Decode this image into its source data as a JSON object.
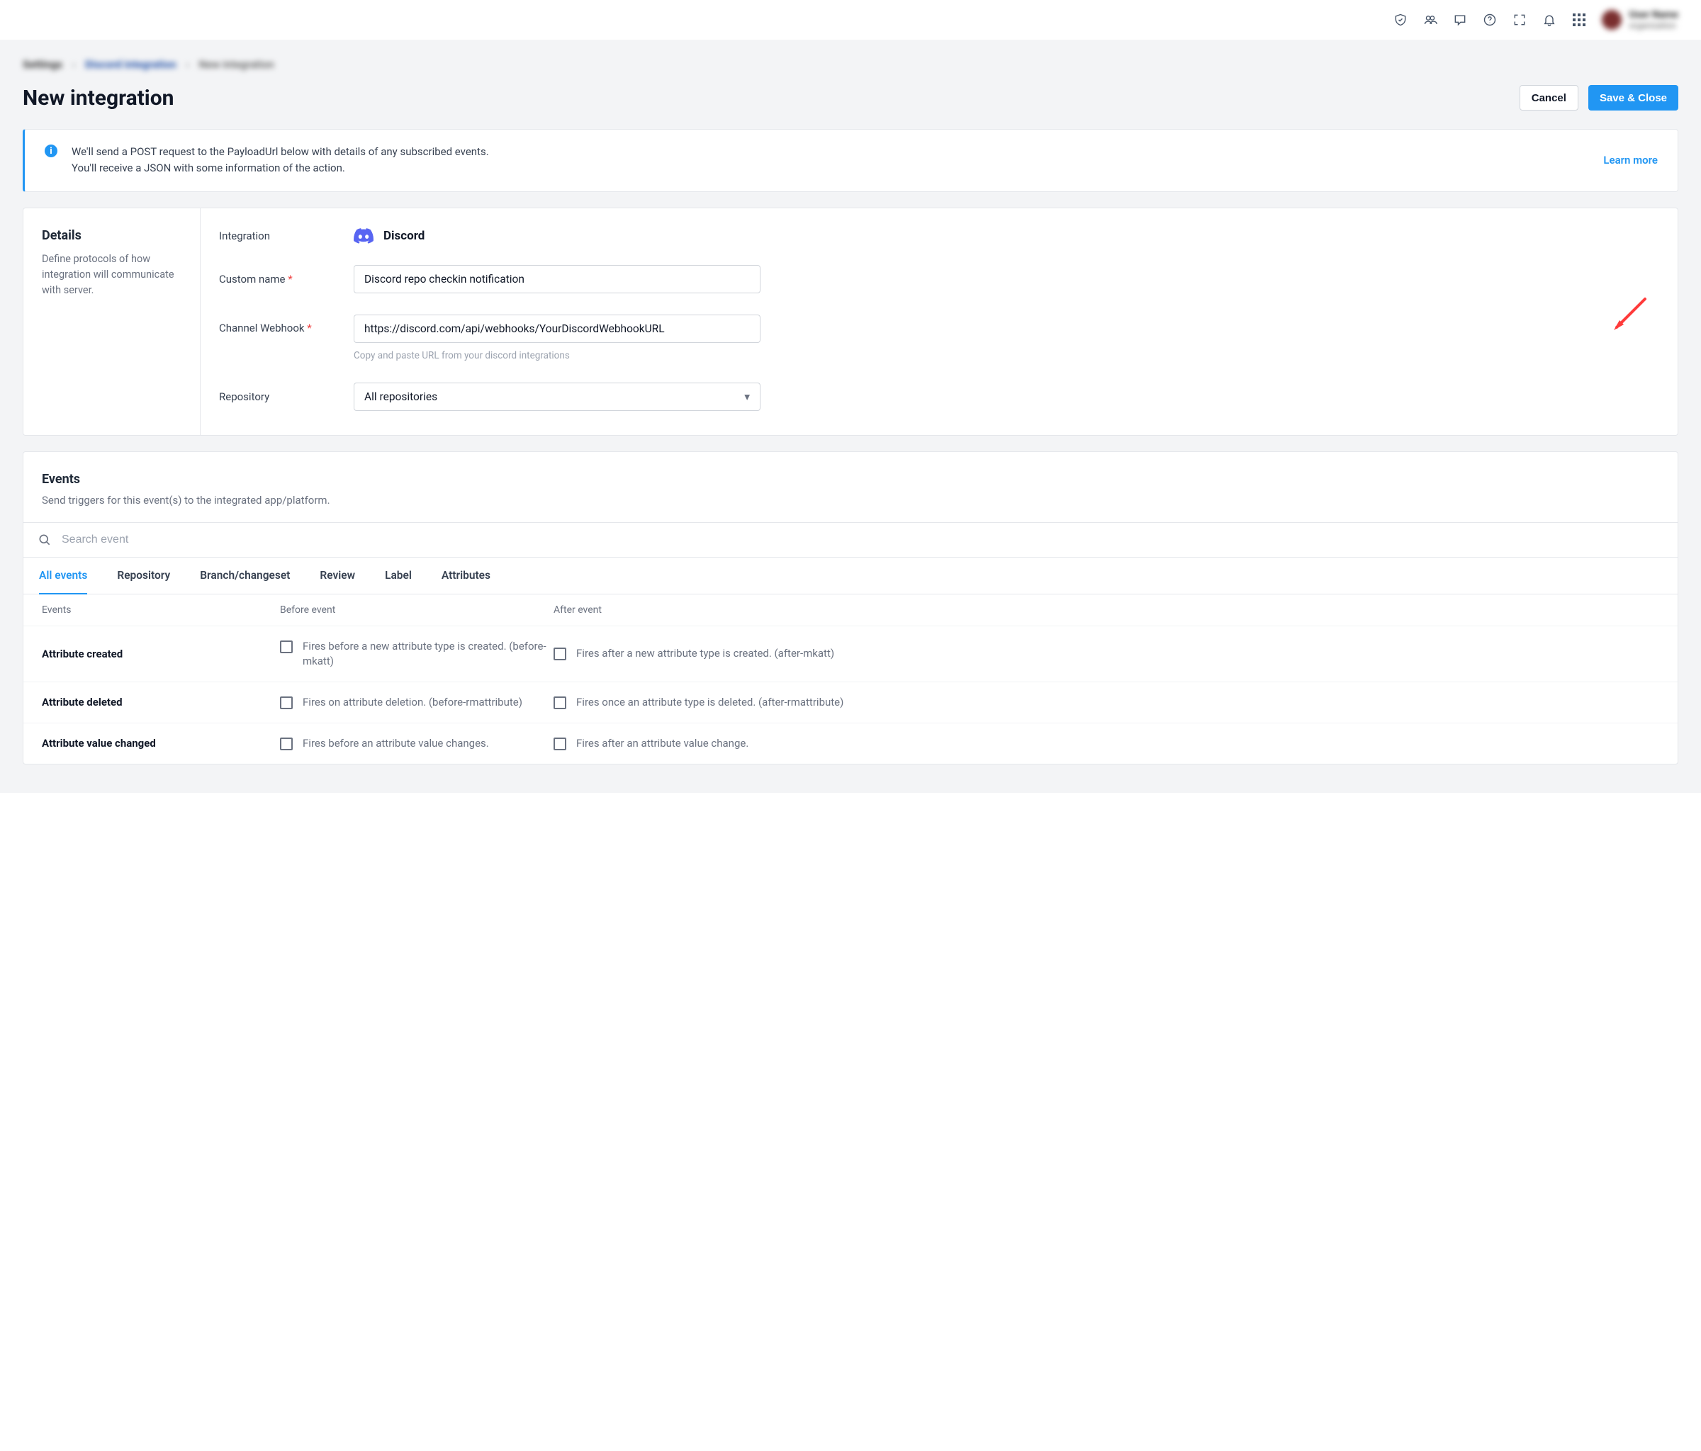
{
  "topnav": {
    "user_name": "User Name",
    "user_org": "organization"
  },
  "breadcrumb": {
    "a": "Settings",
    "b": "Discord integration",
    "c": "New integration"
  },
  "page_title": "New integration",
  "buttons": {
    "cancel": "Cancel",
    "save": "Save & Close"
  },
  "infobox": {
    "line1": "We'll send a POST request to the PayloadUrl below with details of any subscribed events.",
    "line2": "You'll receive a JSON with some information of the action.",
    "learn": "Learn more"
  },
  "details": {
    "heading": "Details",
    "desc": "Define protocols of how integration will communicate with server.",
    "fields": {
      "integration_label": "Integration",
      "integration_value": "Discord",
      "custom_name_label": "Custom name",
      "custom_name_value": "Discord repo checkin notification",
      "webhook_label": "Channel Webhook",
      "webhook_value": "https://discord.com/api/webhooks/YourDiscordWebhookURL",
      "webhook_helper": "Copy and paste URL from your discord integrations",
      "repo_label": "Repository",
      "repo_value": "All repositories"
    }
  },
  "events": {
    "heading": "Events",
    "desc": "Send triggers for this event(s) to the integrated app/platform.",
    "search_placeholder": "Search event",
    "tabs": [
      "All events",
      "Repository",
      "Branch/changeset",
      "Review",
      "Label",
      "Attributes"
    ],
    "active_tab": "All events",
    "columns": {
      "c1": "Events",
      "c2": "Before event",
      "c3": "After event"
    },
    "rows": [
      {
        "name": "Attribute created",
        "before": "Fires before a new attribute type is created. (before-mkatt)",
        "after": "Fires after a new attribute type is created. (after-mkatt)"
      },
      {
        "name": "Attribute deleted",
        "before": "Fires on attribute deletion. (before-rmattribute)",
        "after": "Fires once an attribute type is deleted. (after-rmattribute)"
      },
      {
        "name": "Attribute value changed",
        "before": "Fires before an attribute value changes.",
        "after": "Fires after an attribute value change."
      }
    ]
  }
}
